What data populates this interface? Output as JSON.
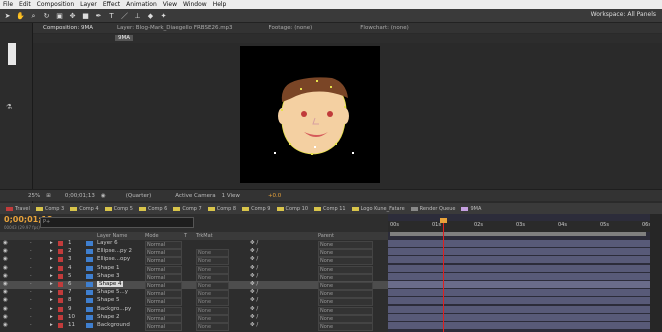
{
  "menu": [
    "File",
    "Edit",
    "Composition",
    "Layer",
    "Effect",
    "Animation",
    "View",
    "Window",
    "Help"
  ],
  "workspace": "Workspace: All Panels",
  "tools": [
    "selection-tool",
    "hand-tool",
    "zoom-tool",
    "rotate-tool",
    "camera-tool",
    "pan-tool",
    "rectangle-tool",
    "pen-tool",
    "type-tool",
    "brush-tool",
    "clone-tool",
    "eraser-tool",
    "puppet-tool"
  ],
  "comp_panel": {
    "tab": "Composition: 9MA",
    "layer_tab": "Layer: Blog-Mark_Diaegello FRBSE26.mp3",
    "footage_tab": "Footage: (none)",
    "flowchart_tab": "Flowchart: (none)",
    "breadcrumb": "9MA"
  },
  "viewer_footer": {
    "zoom": "25%",
    "timecode": "0;00;01;13",
    "resolution": "(Quarter)",
    "camera": "Active Camera",
    "views": "1 View",
    "exposure": "+0.0"
  },
  "timeline_tabs": [
    {
      "label": "Travel",
      "color": "#c23b3b"
    },
    {
      "label": "Comp 3",
      "color": "#d8c44a"
    },
    {
      "label": "Comp 4",
      "color": "#d8c44a"
    },
    {
      "label": "Comp 5",
      "color": "#d8c44a"
    },
    {
      "label": "Comp 6",
      "color": "#d8c44a"
    },
    {
      "label": "Comp 7",
      "color": "#d8c44a"
    },
    {
      "label": "Comp 8",
      "color": "#d8c44a"
    },
    {
      "label": "Comp 9",
      "color": "#d8c44a"
    },
    {
      "label": "Comp 10",
      "color": "#d8c44a"
    },
    {
      "label": "Comp 11",
      "color": "#d8c44a"
    },
    {
      "label": "Logo Kune_Fatare",
      "color": "#d8c44a"
    },
    {
      "label": "Render Queue",
      "color": "#888888"
    },
    {
      "label": "9MA",
      "color": "#c5a0e0"
    }
  ],
  "timecode": "0;00;01;13",
  "timecode_sub": "00043 (29.97 fps)",
  "search_placeholder": "P+",
  "columns": {
    "layer_name": "Layer Name",
    "mode": "Mode",
    "t": "T",
    "trkmat": "TrkMat",
    "parent": "Parent"
  },
  "ruler_labels": [
    "00s",
    "01s",
    "02s",
    "03s",
    "04s",
    "05s",
    "06s"
  ],
  "layers": [
    {
      "num": "1",
      "name": "Layer 6",
      "mode": "Normal",
      "trk": "",
      "parent": "None",
      "label": "#c23b3b",
      "selected": false
    },
    {
      "num": "2",
      "name": "Ellipse...py 2",
      "mode": "Normal",
      "trk": "None",
      "parent": "None",
      "label": "#c23b3b",
      "selected": false
    },
    {
      "num": "3",
      "name": "Ellipse...opy",
      "mode": "Normal",
      "trk": "None",
      "parent": "None",
      "label": "#c23b3b",
      "selected": false
    },
    {
      "num": "4",
      "name": "Shape 1",
      "mode": "Normal",
      "trk": "None",
      "parent": "None",
      "label": "#c23b3b",
      "selected": false
    },
    {
      "num": "5",
      "name": "Shape 3",
      "mode": "Normal",
      "trk": "None",
      "parent": "None",
      "label": "#c23b3b",
      "selected": false
    },
    {
      "num": "6",
      "name": "Shape 4",
      "mode": "Normal",
      "trk": "None",
      "parent": "None",
      "label": "#c23b3b",
      "selected": true
    },
    {
      "num": "7",
      "name": "Shape 5...y",
      "mode": "Normal",
      "trk": "None",
      "parent": "None",
      "label": "#c23b3b",
      "selected": false
    },
    {
      "num": "8",
      "name": "Shape 5",
      "mode": "Normal",
      "trk": "None",
      "parent": "None",
      "label": "#c23b3b",
      "selected": false
    },
    {
      "num": "9",
      "name": "Backgro...py",
      "mode": "Normal",
      "trk": "None",
      "parent": "None",
      "label": "#c23b3b",
      "selected": false
    },
    {
      "num": "10",
      "name": "Shape 2",
      "mode": "Normal",
      "trk": "None",
      "parent": "None",
      "label": "#c23b3b",
      "selected": false
    },
    {
      "num": "11",
      "name": "Background",
      "mode": "Normal",
      "trk": "None",
      "parent": "None",
      "label": "#c23b3b",
      "selected": false
    }
  ],
  "colors": {
    "timecode": "#e8a33b",
    "playhead": "#e02020",
    "track_bar": "#585a78"
  }
}
